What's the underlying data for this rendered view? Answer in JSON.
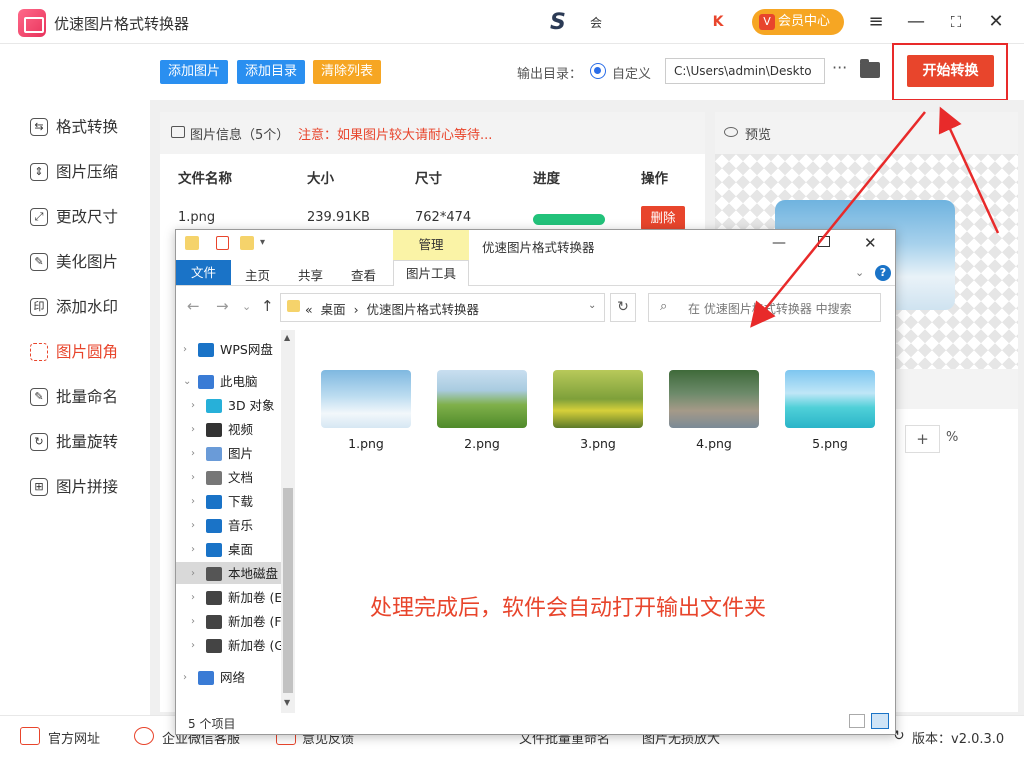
{
  "app": {
    "title": "优速图片格式转换器",
    "brand_text": "会",
    "vip_mark": "K",
    "member_center": "会员中心",
    "member_icon": "V",
    "win_controls": {
      "menu": "≡",
      "minimize": "—",
      "maximize": "⛶",
      "close": "✕"
    }
  },
  "sidebar": {
    "items": [
      {
        "label": "格式转换",
        "icon": "convert-icon",
        "glyph": "⇆"
      },
      {
        "label": "图片压缩",
        "icon": "compress-icon",
        "glyph": "⇕"
      },
      {
        "label": "更改尺寸",
        "icon": "resize-icon",
        "glyph": "⤢"
      },
      {
        "label": "美化图片",
        "icon": "beautify-icon",
        "glyph": "✎"
      },
      {
        "label": "添加水印",
        "icon": "watermark-icon",
        "glyph": "印"
      },
      {
        "label": "图片圆角",
        "icon": "round-corner-icon",
        "glyph": ""
      },
      {
        "label": "批量命名",
        "icon": "rename-icon",
        "glyph": "✎"
      },
      {
        "label": "批量旋转",
        "icon": "rotate-icon",
        "glyph": "↻"
      },
      {
        "label": "图片拼接",
        "icon": "stitch-icon",
        "glyph": "⊞"
      }
    ],
    "active_index": 5
  },
  "toolbar": {
    "add_image": "添加图片",
    "add_dir": "添加目录",
    "clear_list": "清除列表",
    "output_dir_label": "输出目录：",
    "custom_label": "自定义",
    "output_path": "C:\\Users\\admin\\Deskto",
    "more": "···",
    "start": "开始转换"
  },
  "info": {
    "title": "图片信息（5个）",
    "note": "注意：如果图片较大请耐心等待...",
    "columns": [
      "文件名称",
      "大小",
      "尺寸",
      "进度",
      "操作"
    ],
    "rows": [
      {
        "name": "1.png",
        "size": "239.91KB",
        "dims": "762*474",
        "progress": 1.0,
        "action": "删除"
      }
    ]
  },
  "preview": {
    "label": "预览",
    "zoom_plus": "+",
    "zoom_unit": "%"
  },
  "footer": {
    "items": [
      "官方网址",
      "企业微信客服",
      "意见反馈",
      "文件批量重命名",
      "图片无损放大"
    ],
    "version": "版本：v2.0.3.0"
  },
  "explorer": {
    "manage_tab": "管理",
    "title": "优速图片格式转换器",
    "tabs": [
      "文件",
      "主页",
      "共享",
      "查看",
      "图片工具"
    ],
    "address": [
      "«",
      "桌面",
      "›",
      "优速图片格式转换器"
    ],
    "search_placeholder": "在 优速图片格式转换器 中搜索",
    "nav": [
      {
        "label": "WPS网盘",
        "icon": "cloud-icon"
      },
      {
        "label": "此电脑",
        "icon": "computer-icon"
      },
      {
        "label": "3D 对象",
        "icon": "3d-objects-icon"
      },
      {
        "label": "视频",
        "icon": "video-icon"
      },
      {
        "label": "图片",
        "icon": "pictures-icon"
      },
      {
        "label": "文档",
        "icon": "documents-icon"
      },
      {
        "label": "下载",
        "icon": "download-icon"
      },
      {
        "label": "音乐",
        "icon": "music-icon"
      },
      {
        "label": "桌面",
        "icon": "desktop-icon"
      },
      {
        "label": "本地磁盘",
        "icon": "local-disk-icon"
      },
      {
        "label": "新加卷 (E",
        "icon": "drive-icon"
      },
      {
        "label": "新加卷 (F",
        "icon": "drive-icon"
      },
      {
        "label": "新加卷 (G",
        "icon": "drive-icon"
      },
      {
        "label": "网络",
        "icon": "network-icon"
      }
    ],
    "files": [
      "1.png",
      "2.png",
      "3.png",
      "4.png",
      "5.png"
    ],
    "status": "5 个项目",
    "message": "处理完成后，软件会自动打开输出文件夹"
  },
  "colors": {
    "accent": "#e8452c",
    "blue_btn": "#2a8ff0",
    "orange_btn": "#f6a623",
    "progress": "#22c27a"
  }
}
